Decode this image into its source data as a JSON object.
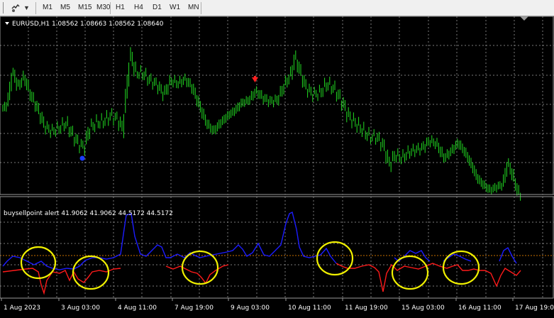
{
  "toolbar": {
    "tools_icon": "hand-pointer-icon",
    "dropdown_icon": "chevron-down-icon",
    "timeframes": [
      "M1",
      "M5",
      "M15",
      "M30",
      "H1",
      "H4",
      "D1",
      "W1",
      "MN"
    ]
  },
  "main_chart": {
    "header": "EURUSD,H1  1.08562 1.08663 1.08562 1.08640",
    "bull_color": "#22dd22",
    "grid_color": "#7a7a7a",
    "up_arrow_color": "#1a3cff",
    "down_arrow_color": "#ff2020"
  },
  "indicator": {
    "header": "buysellpoint alert 41.9062 41.9062 44.5172 44.5172",
    "blue_color": "#1c1cff",
    "red_color": "#ff1a1a",
    "level_color": "#c87000",
    "highlight_color": "#f0f000"
  },
  "time_axis": [
    "1 Aug 2023",
    "3 Aug 03:00",
    "4 Aug 11:00",
    "7 Aug 19:00",
    "9 Aug 03:00",
    "10 Aug 11:00",
    "11 Aug 19:00",
    "15 Aug 03:00",
    "16 Aug 11:00",
    "17 Aug 19:00"
  ]
}
